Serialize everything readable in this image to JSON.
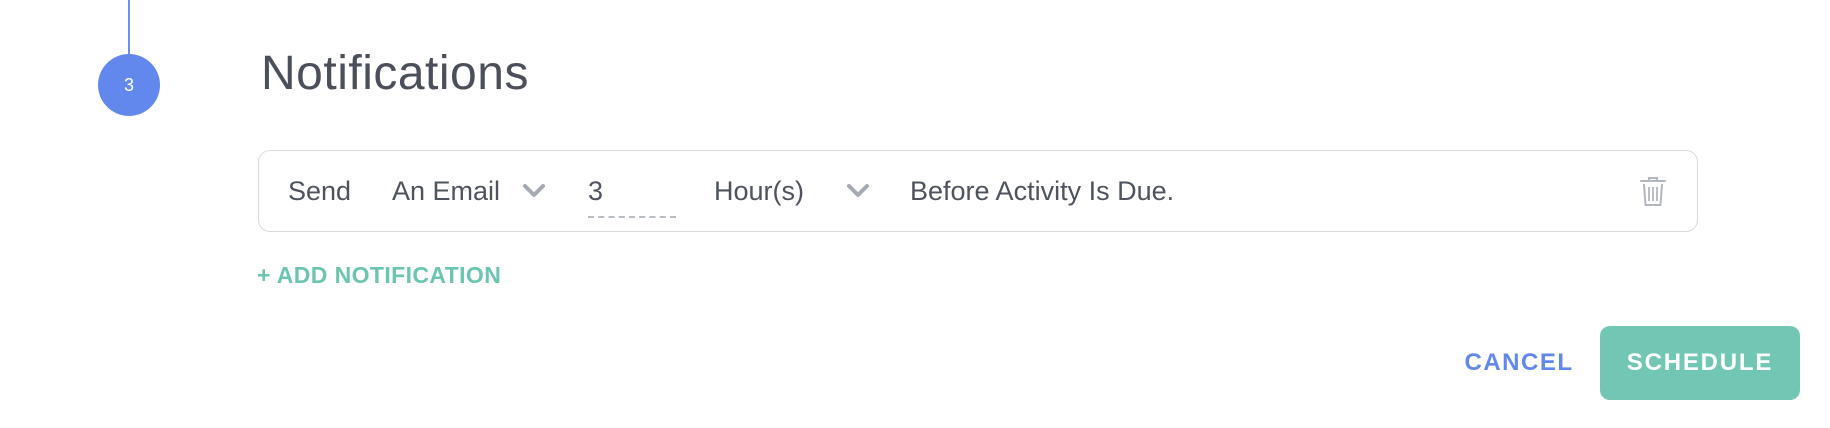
{
  "step": {
    "number": "3",
    "title": "Notifications",
    "accent_color": "#6288ed"
  },
  "notification": {
    "send_label": "Send",
    "method_value": "An Email",
    "amount_value": "3",
    "unit_value": "Hour(s)",
    "suffix_label": "Before Activity Is Due.",
    "method_chevron_icon": "chevron-down-icon",
    "unit_chevron_icon": "chevron-down-icon",
    "delete_icon": "trash-icon"
  },
  "add_notification_label": "+ ADD NOTIFICATION",
  "actions": {
    "cancel_label": "CANCEL",
    "schedule_label": "SCHEDULE",
    "cancel_color": "#6288ed",
    "schedule_color": "#72c6b4"
  }
}
